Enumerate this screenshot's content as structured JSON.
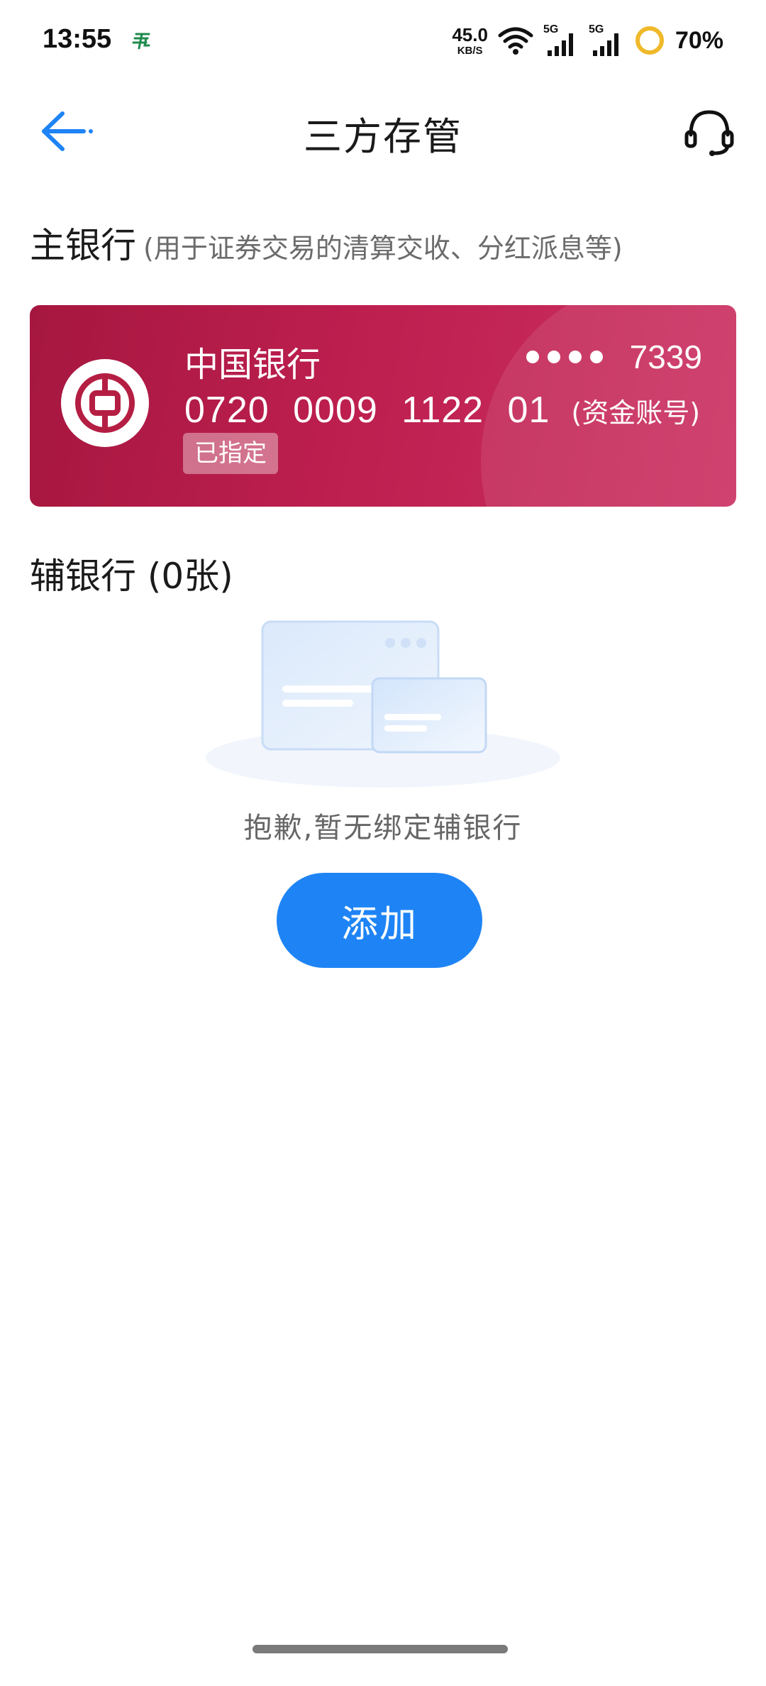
{
  "status_bar": {
    "time": "13:55",
    "net_speed_value": "45.0",
    "net_speed_unit": "KB/S",
    "signal_1_label": "5G",
    "signal_2_label": "5G",
    "battery": "70%",
    "icons": [
      "china-post-icon",
      "wifi-icon",
      "signal-icon",
      "battery-ring-icon"
    ]
  },
  "nav": {
    "title": "三方存管",
    "back_icon": "back-arrow-icon",
    "service_icon": "headset-icon"
  },
  "main_bank": {
    "title": "主银行",
    "subtitle": "(用于证券交易的清算交收、分红派息等)",
    "card": {
      "bank_name": "中国银行",
      "masked_tail": "7339",
      "account_number": "0720 0009 1122 01",
      "account_tag": "(资金账号)",
      "status": "已指定",
      "color": "#bd1f4f"
    }
  },
  "aux_bank": {
    "title": "辅银行 (0张)",
    "empty_text": "抱歉,暂无绑定辅银行",
    "add_label": "添加",
    "accent": "#1e84f5"
  }
}
